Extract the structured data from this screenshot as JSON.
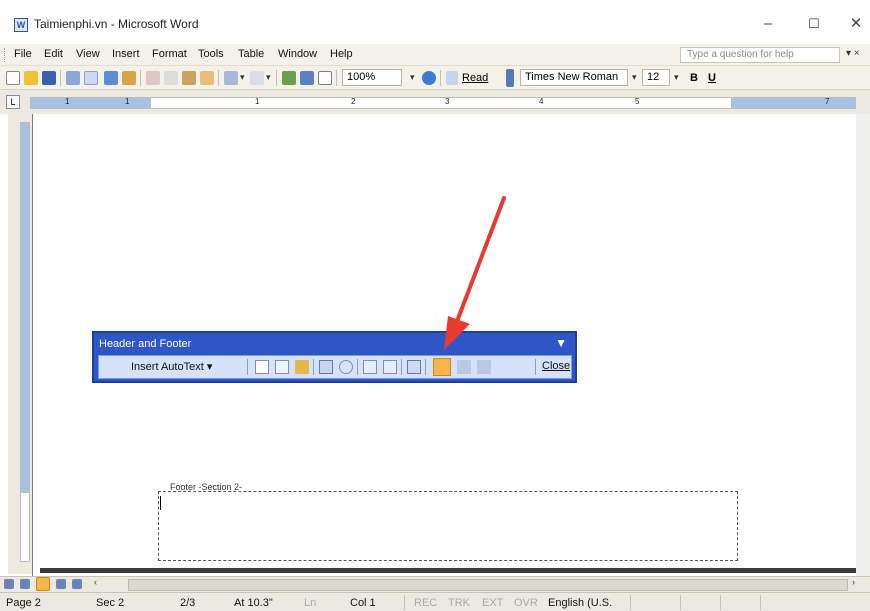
{
  "window": {
    "title": "Taimienphi.vn - Microsoft Word",
    "minimize": "–",
    "maximize": "☐",
    "close": "✕"
  },
  "menu": {
    "items": [
      "File",
      "Edit",
      "View",
      "Insert",
      "Format",
      "Tools",
      "Table",
      "Window",
      "Help"
    ],
    "question_placeholder": "Type a question for help"
  },
  "toolbar": {
    "zoom": "100%",
    "read": "Read",
    "font": "Times New Roman",
    "size": "12",
    "bold": "B",
    "underline": "U"
  },
  "ruler": {
    "numbers": [
      "1",
      "1",
      "2",
      "3",
      "4",
      "5",
      "7"
    ]
  },
  "header_footer_toolbar": {
    "title": "Header and Footer",
    "insert_autotext": "Insert AutoText ▾",
    "close": "Close"
  },
  "document": {
    "footer_label": "Footer -Section 2-"
  },
  "status": {
    "page": "Page 2",
    "sec": "Sec 2",
    "pages": "2/3",
    "at": "At 10.3\"",
    "ln": "Ln",
    "col": "Col 1",
    "rec": "REC",
    "trk": "TRK",
    "ext": "EXT",
    "ovr": "OVR",
    "language": "English (U.S."
  },
  "colors": {
    "hf_title_bg": "#2f56c6",
    "arrow": "#e83a2f",
    "active_button": "#f5b54a"
  }
}
